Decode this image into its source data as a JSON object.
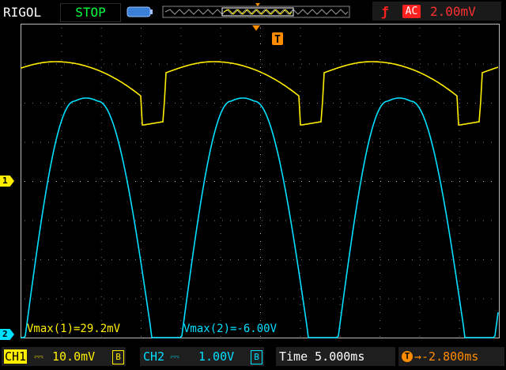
{
  "top_bar": {
    "brand": "RIGOL",
    "run_state": "STOP",
    "trigger": {
      "edge_icon": "rising-edge-icon",
      "coupling": "AC",
      "level": "2.00mV"
    }
  },
  "markers": {
    "trigger_position": "T",
    "ch1": "1",
    "ch2": "2"
  },
  "measurements": {
    "ch1": "Vmax(1)=29.2mV",
    "ch2": "Vmax(2)=-6.00V"
  },
  "bottom_bar": {
    "ch1_name": "CH1",
    "ch1_coupling_icon": "dc-coupling-icon",
    "ch1_scale": "10.0mV",
    "ch1_bw": "B",
    "ch2_name": "CH2",
    "ch2_coupling_icon": "dc-coupling-icon",
    "ch2_scale": "1.00V",
    "ch2_bw": "B",
    "timebase": "Time 5.000ms",
    "trigger_offset": "→-2.800ms"
  },
  "colors": {
    "ch1": "#ffee00",
    "ch2": "#00e0ff",
    "trigger": "#ff2020",
    "trigger_offset": "#ff8c00",
    "run_state": "#00ff40"
  }
}
